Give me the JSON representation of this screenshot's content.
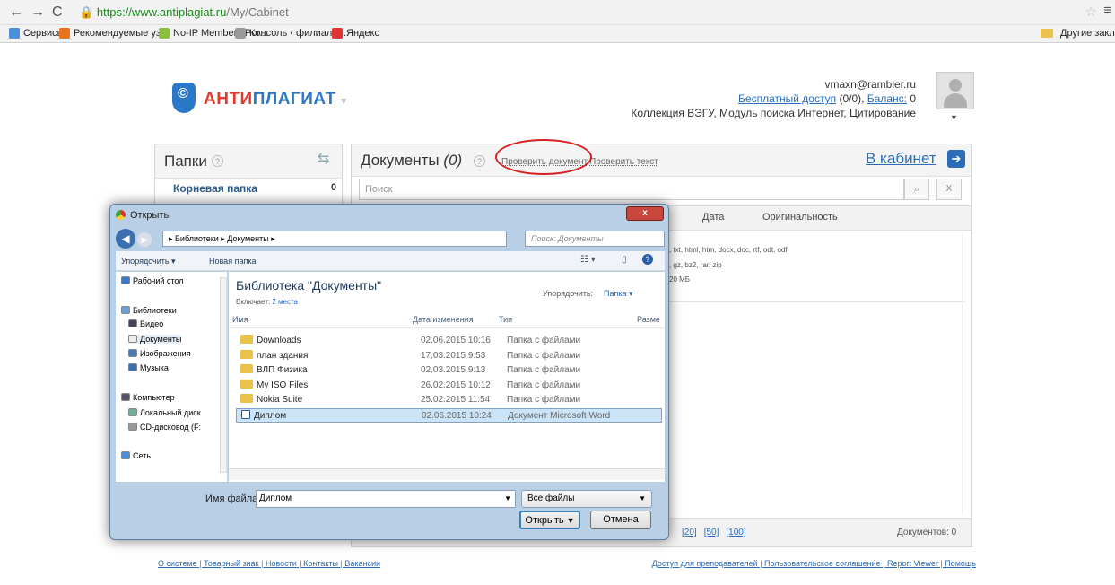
{
  "browser": {
    "url_domain": "https://www.antiplagiat.ru",
    "url_path": "/My/Cabinet",
    "bookmarks": [
      {
        "label": "Сервисы",
        "color": "#4a90d9"
      },
      {
        "label": "Рекомендуемые уз...",
        "color": "#e8731c"
      },
      {
        "label": "No-IP Members Por...",
        "color": "#8cbf3f"
      },
      {
        "label": "Консоль ‹ филиал К...",
        "color": "#999999"
      },
      {
        "label": "Яндекс",
        "color": "#d33"
      }
    ],
    "other_bookmarks": "Другие закладки"
  },
  "logo": {
    "part1": "АНТИ",
    "part2": "ПЛАГИАТ",
    "color1": "#e23a2e",
    "color2": "#2c78c8"
  },
  "account": {
    "email": "vmaxn@rambler.ru",
    "free_access": "Бесплатный доступ",
    "free_count": " (0/0), ",
    "balance_label": "Баланс:",
    "balance_value": " 0",
    "collections": "Коллекция ВЭГУ, Модуль поиска Интернет, Цитирование"
  },
  "folders": {
    "title": "Папки",
    "help": "?",
    "root": "Корневая папка",
    "root_count": "0"
  },
  "documents": {
    "title": "Документы",
    "count": "(0)",
    "help": "?",
    "check_doc": "Проверить документ",
    "check_text": "Проверить текст",
    "to_cabinet": "В кабинет",
    "search_placeholder": "Поиск",
    "search_clear": "X",
    "col_date": "Дата",
    "col_orig": "Оригинальность",
    "formats1": ", txt, html, htm, docx, doc, rtf, odt, odf",
    "formats2": ", gz, bz2, rar, zip",
    "size": "20 МБ",
    "pages": [
      "[20]",
      "[50]",
      "[100]"
    ],
    "total": "Документов: 0"
  },
  "dialog": {
    "title": "Открыть",
    "path": "▸ Библиотеки ▸ Документы ▸",
    "search_placeholder": "Поиск: Документы",
    "organize": "Упорядочить ▾",
    "new_folder": "Новая папка",
    "nav": [
      {
        "label": "Рабочий стол"
      },
      {
        "label": "Библиотеки"
      },
      {
        "label": "Видео"
      },
      {
        "label": "Документы"
      },
      {
        "label": "Изображения"
      },
      {
        "label": "Музыка"
      },
      {
        "label": "Компьютер"
      },
      {
        "label": "Локальный диск"
      },
      {
        "label": "CD-дисковод (F:"
      },
      {
        "label": "Сеть"
      }
    ],
    "lib_title": "Библиотека \"Документы\"",
    "lib_includes": "Включает:",
    "lib_places": "2 места",
    "arrange_label": "Упорядочить:",
    "arrange_value": "Папка ▾",
    "cols": [
      "Имя",
      "Дата изменения",
      "Тип",
      "Разме"
    ],
    "files": [
      {
        "name": "Downloads",
        "date": "02.06.2015 10:16",
        "type": "Папка с файлами"
      },
      {
        "name": "план здания",
        "date": "17.03.2015 9:53",
        "type": "Папка с файлами"
      },
      {
        "name": "ВЛП Физика",
        "date": "02.03.2015 9:13",
        "type": "Папка с файлами"
      },
      {
        "name": "My ISO Files",
        "date": "26.02.2015 10:12",
        "type": "Папка с файлами"
      },
      {
        "name": "Nokia Suite",
        "date": "25.02.2015 11:54",
        "type": "Папка с файлами"
      },
      {
        "name": "Диплом",
        "date": "02.06.2015 10:24",
        "type": "Документ Microsoft Word"
      }
    ],
    "filename_label": "Имя файла:",
    "filename_value": "Диплом",
    "filter": "Все файлы",
    "open": "Открыть",
    "cancel": "Отмена"
  },
  "footer_left": [
    "О системе",
    "Товарный знак",
    "Новости",
    "Контакты",
    "Вакансии"
  ],
  "footer_right": [
    "Доступ для преподавателей",
    "Пользовательское соглашение",
    "Report Viewer",
    "Помощь"
  ]
}
